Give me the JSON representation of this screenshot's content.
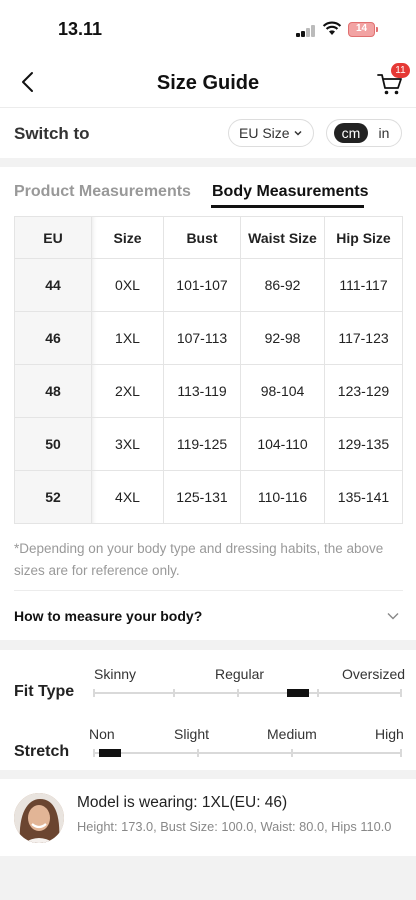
{
  "status_bar": {
    "time": "13.11",
    "battery": "14"
  },
  "nav": {
    "title": "Size Guide",
    "cart_count": "11"
  },
  "switch_row": {
    "label": "Switch to",
    "size_system": "EU Size",
    "unit_selected": "cm",
    "unit_other": "in"
  },
  "tabs": [
    {
      "label": "Product Measurements",
      "active": false
    },
    {
      "label": "Body Measurements",
      "active": true
    }
  ],
  "table": {
    "headers": [
      "EU",
      "Size",
      "Bust",
      "Waist Size",
      "Hip Size"
    ],
    "rows": [
      [
        "44",
        "0XL",
        "101-107",
        "86-92",
        "111-117"
      ],
      [
        "46",
        "1XL",
        "107-113",
        "92-98",
        "117-123"
      ],
      [
        "48",
        "2XL",
        "113-119",
        "98-104",
        "123-129"
      ],
      [
        "50",
        "3XL",
        "119-125",
        "104-110",
        "129-135"
      ],
      [
        "52",
        "4XL",
        "125-131",
        "110-116",
        "135-141"
      ]
    ]
  },
  "note": "*Depending on your body type and dressing habits, the above sizes are for reference only.",
  "how_to_measure": "How to measure your body?",
  "fit_type": {
    "label": "Fit Type",
    "scale": [
      "Skinny",
      "Regular",
      "Oversized"
    ],
    "level": 0.675
  },
  "stretch": {
    "label": "Stretch",
    "scale": [
      "Non",
      "Slight",
      "Medium",
      "High"
    ],
    "level": 0.02
  },
  "model": {
    "wearing": "Model is wearing: 1XL(EU: 46)",
    "details": "Height: 173.0,  Bust Size: 100.0,  Waist: 80.0,  Hips 110.0"
  },
  "colors": {
    "accent_dark": "#111111",
    "badge_red": "#e53935",
    "muted_text": "#999999"
  }
}
